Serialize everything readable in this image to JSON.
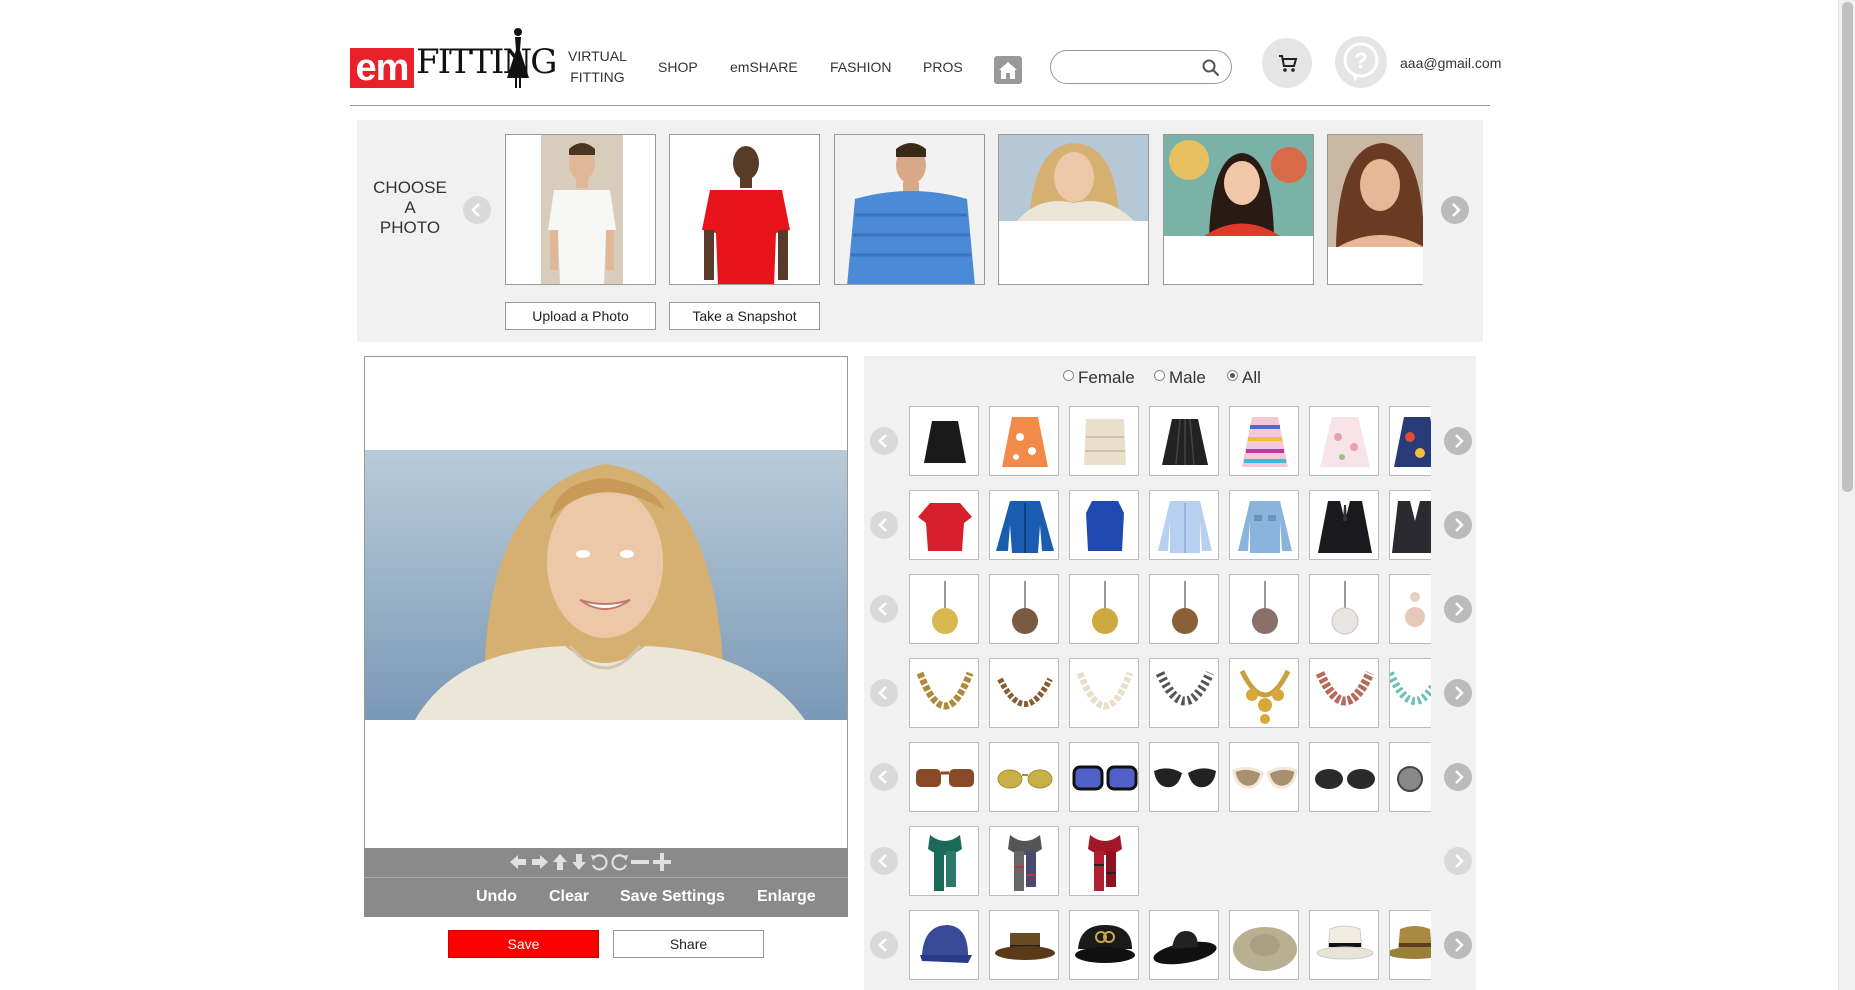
{
  "brand": {
    "logo_em": "em",
    "logo_fitting": "FITTING"
  },
  "nav": [
    {
      "label_line1": "VIRTUAL",
      "label_line2": "FITTING"
    },
    {
      "label_line1": "SHOP"
    },
    {
      "label_line1": "emSHARE"
    },
    {
      "label_line1": "FASHION"
    },
    {
      "label_line1": "PROS"
    }
  ],
  "search": {
    "placeholder": "",
    "value": ""
  },
  "user": {
    "email": "aaa@gmail.com"
  },
  "choose": {
    "label_line1": "CHOOSE",
    "label_line2": "A",
    "label_line3": "PHOTO",
    "upload_label": "Upload a Photo",
    "snapshot_label": "Take a Snapshot"
  },
  "editor": {
    "undo_label": "Undo",
    "clear_label": "Clear",
    "save_settings_label": "Save Settings",
    "enlarge_label": "Enlarge",
    "save_label": "Save",
    "share_label": "Share"
  },
  "filter": {
    "female": "Female",
    "male": "Male",
    "all": "All",
    "selected": "All"
  },
  "colors": {
    "brand_red": "#e8202a",
    "save_red": "#ff0000",
    "panel_gray": "#f1f1f1",
    "control_gray": "#8a8a8a"
  },
  "catalog_rows": [
    {
      "category": "skirts",
      "items": [
        "black-skirt",
        "orange-floral-skirt",
        "beige-lace-skirt",
        "black-pleated-skirt",
        "striped-skirt",
        "pink-floral-skirt",
        "print-skirt"
      ]
    },
    {
      "category": "tops",
      "items": [
        "red-tshirt",
        "blue-jacket",
        "blue-sleeveless",
        "light-blue-shirt",
        "denim-shirt",
        "black-suit",
        "dark-suit"
      ]
    },
    {
      "category": "earrings",
      "items": [
        "gold-pearl-earring",
        "bronze-pearl-earring",
        "gold-pearl-earring-2",
        "bronze-pearl-earring-2",
        "mauve-pearl-earring",
        "white-pearl-earring",
        "pink-pearl-earring"
      ]
    },
    {
      "category": "necklaces",
      "items": [
        "gold-bead-necklace",
        "bronze-bead-necklace",
        "pearl-necklace",
        "crystal-necklace",
        "gold-statement-necklace",
        "pink-statement-necklace",
        "turquoise-necklace"
      ]
    },
    {
      "category": "sunglasses",
      "items": [
        "tortoise-sunglasses",
        "gold-aviators",
        "blue-sunglasses",
        "black-cateye",
        "white-cateye",
        "black-gradient",
        "grey-round"
      ]
    },
    {
      "category": "scarves",
      "items": [
        "green-plaid-scarf",
        "grey-plaid-scarf",
        "red-plaid-scarf"
      ]
    },
    {
      "category": "hats",
      "items": [
        "blue-cap",
        "brown-porkpie",
        "black-chanel-cap",
        "black-floppy-hat",
        "straw-wide-hat",
        "white-fedora",
        "straw-fedora"
      ]
    }
  ]
}
